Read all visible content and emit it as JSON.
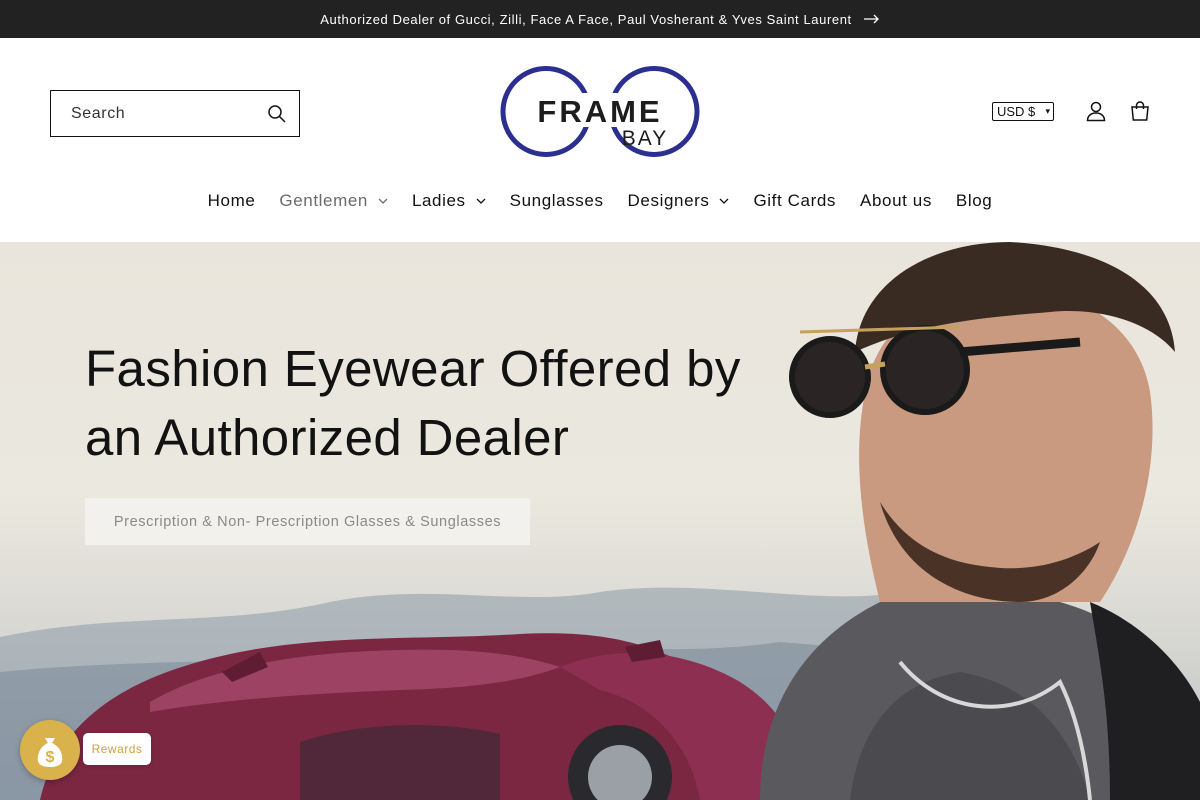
{
  "announcement": {
    "text": "Authorized Dealer of Gucci, Zilli, Face A Face, Paul Vosherant & Yves Saint Laurent",
    "icon": "arrow-right-icon"
  },
  "header": {
    "search": {
      "placeholder": "Search",
      "icon": "search-icon"
    },
    "logo": {
      "line1": "FRAME",
      "line2": "BAY",
      "color": "#2b2f8f"
    },
    "currency": {
      "selected": "USD $"
    },
    "account_icon": "account-icon",
    "cart_icon": "cart-icon"
  },
  "nav": {
    "items": [
      {
        "label": "Home"
      },
      {
        "label": "Gentlemen"
      },
      {
        "label": "Ladies"
      },
      {
        "label": "Sunglasses"
      },
      {
        "label": "Designers"
      },
      {
        "label": "Gift Cards"
      },
      {
        "label": "About us"
      },
      {
        "label": "Blog"
      }
    ]
  },
  "hero": {
    "title": "Fashion Eyewear Offered by an Authorized Dealer",
    "button_label": "Prescription & Non- Prescription Glasses & Sunglasses"
  },
  "rewards": {
    "label": "Rewards",
    "icon": "money-bag-icon",
    "color": "#d9b24c"
  }
}
